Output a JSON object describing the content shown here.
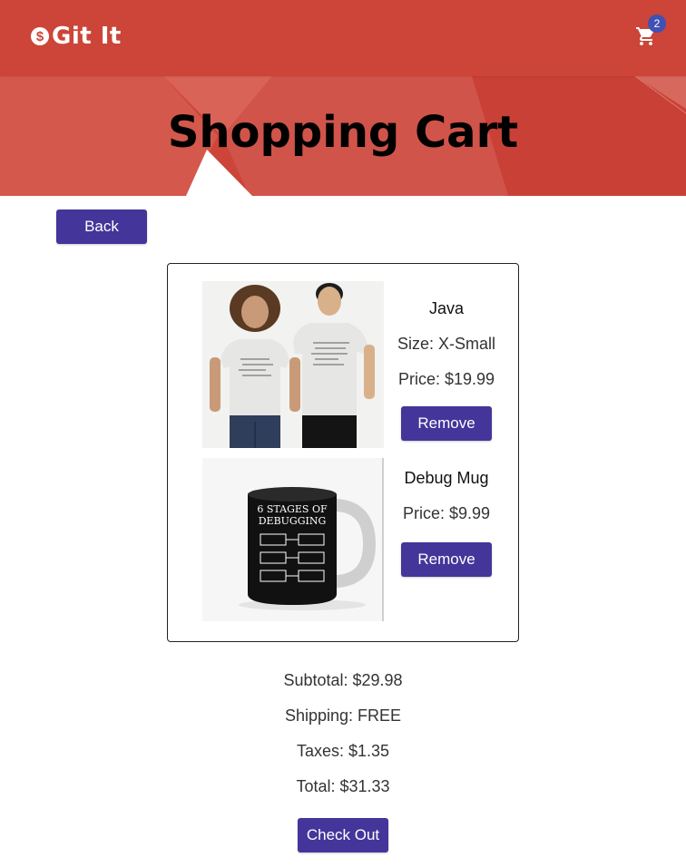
{
  "app": {
    "brand": "Git It",
    "brand_icon": "dollar-icon"
  },
  "header": {
    "cart_count": "2",
    "cart_icon": "shopping-cart-icon",
    "color": "#cc4538"
  },
  "page": {
    "title": "Shopping Cart",
    "back_label": "Back"
  },
  "cart": {
    "items": [
      {
        "name": "Java",
        "size": "Size: X-Small",
        "price": "Price: $19.99",
        "remove_label": "Remove",
        "image": "t-shirt-photo"
      },
      {
        "name": "Debug Mug",
        "price": "Price: $9.99",
        "remove_label": "Remove",
        "image": "mug-photo",
        "mug_text": "6 STAGES OF DEBUGGING"
      }
    ]
  },
  "summary": {
    "subtotal": "Subtotal: $29.98",
    "shipping": "Shipping: FREE",
    "taxes": "Taxes: $1.35",
    "total": "Total: $31.33"
  },
  "checkout": {
    "label": "Check Out"
  },
  "colors": {
    "accent": "#44359a",
    "header": "#cc4538",
    "badge": "#3f51b5"
  }
}
